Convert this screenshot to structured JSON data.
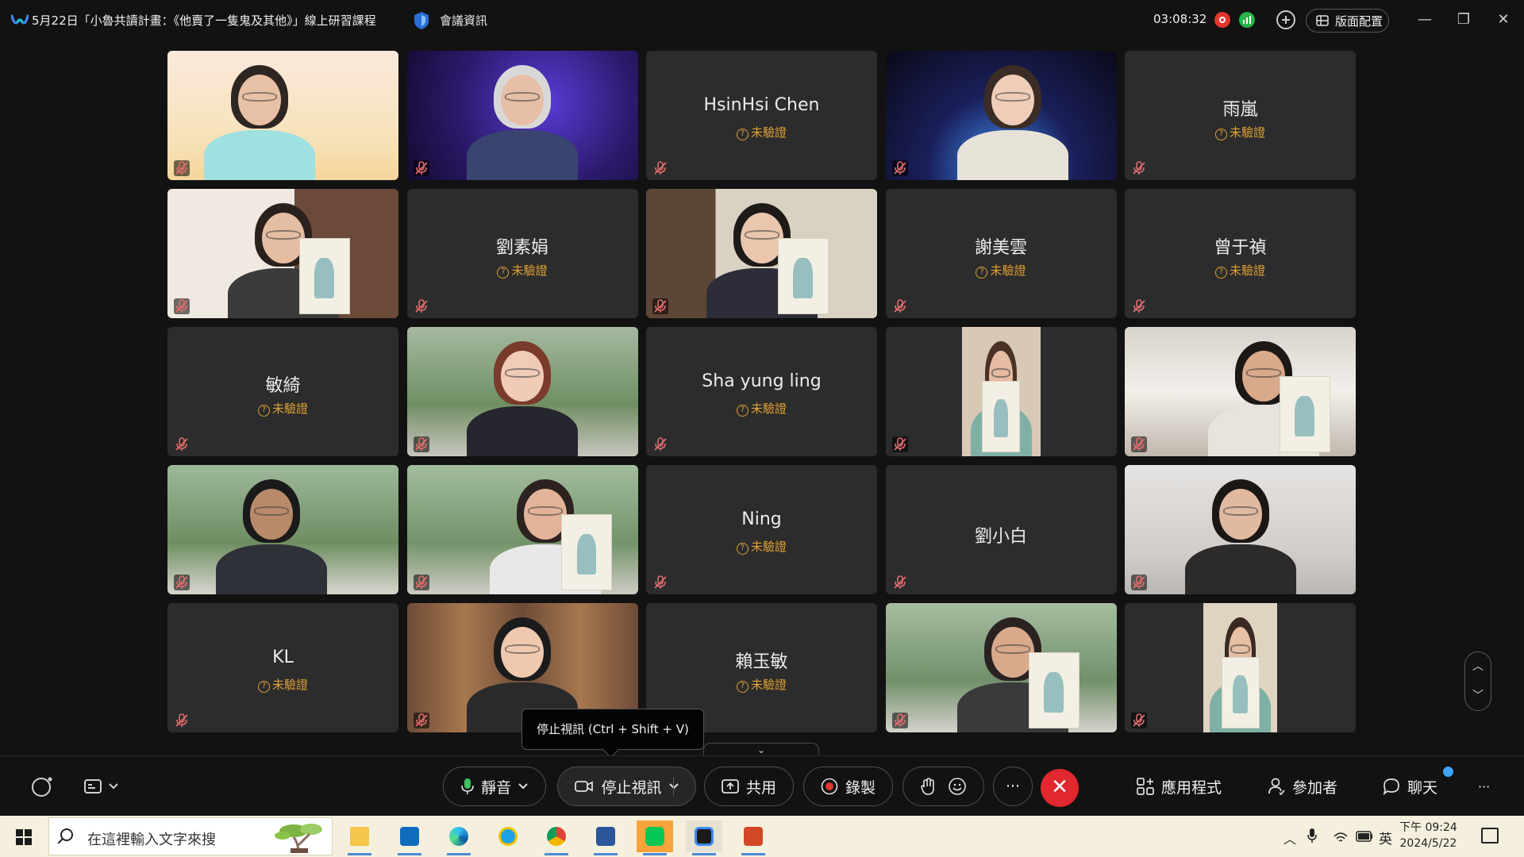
{
  "window": {
    "title": "5月22日「小魯共讀計畫：《他賣了一隻鬼及其他》」線上研習課程",
    "meeting_info_label": "會議資訊",
    "timer": "03:08:32",
    "layout_label": "版面配置",
    "minimize_glyph": "—",
    "restore_glyph": "❐",
    "close_glyph": "✕"
  },
  "participants": [
    {
      "name": "",
      "status": "",
      "video": true
    },
    {
      "name": "",
      "status": "",
      "video": true
    },
    {
      "name": "HsinHsi Chen",
      "status": "未驗證",
      "video": false
    },
    {
      "name": "",
      "status": "",
      "video": true
    },
    {
      "name": "雨嵐",
      "status": "未驗證",
      "video": false
    },
    {
      "name": "",
      "status": "",
      "video": true
    },
    {
      "name": "劉素娟",
      "status": "未驗證",
      "video": false
    },
    {
      "name": "",
      "status": "",
      "video": true
    },
    {
      "name": "謝美雲",
      "status": "未驗證",
      "video": false
    },
    {
      "name": "曾于禎",
      "status": "未驗證",
      "video": false
    },
    {
      "name": "敏綺",
      "status": "未驗證",
      "video": false
    },
    {
      "name": "",
      "status": "",
      "video": true
    },
    {
      "name": "Sha yung ling",
      "status": "未驗證",
      "video": false
    },
    {
      "name": "",
      "status": "",
      "video": true
    },
    {
      "name": "",
      "status": "",
      "video": true
    },
    {
      "name": "",
      "status": "",
      "video": true
    },
    {
      "name": "",
      "status": "",
      "video": true
    },
    {
      "name": "Ning",
      "status": "未驗證",
      "video": false
    },
    {
      "name": "劉小白",
      "status": "",
      "video": false
    },
    {
      "name": "",
      "status": "",
      "video": true
    },
    {
      "name": "KL",
      "status": "未驗證",
      "video": false
    },
    {
      "name": "",
      "status": "",
      "video": true
    },
    {
      "name": "賴玉敏",
      "status": "未驗證",
      "video": false
    },
    {
      "name": "",
      "status": "",
      "video": true
    },
    {
      "name": "",
      "status": "",
      "video": true
    }
  ],
  "tooltip": "停止視訊 (Ctrl + Shift + V)",
  "toolbar": {
    "mute_label": "靜音",
    "stop_video_label": "停止視訊",
    "share_label": "共用",
    "record_label": "錄製",
    "more_glyph": "···",
    "end_glyph": "✕",
    "apps_label": "應用程式",
    "participants_label": "參加者",
    "chat_label": "聊天",
    "overflow_glyph": "···"
  },
  "taskbar": {
    "search_placeholder": "在這裡輸入文字來搜",
    "ime_label": "英",
    "time": "下午 09:24",
    "date": "2024/5/22",
    "apps": [
      "file-explorer-icon",
      "outlook-icon",
      "edge-icon",
      "internet-explorer-icon",
      "chrome-icon",
      "word-icon",
      "line-icon",
      "webex-icon",
      "powerpoint-icon"
    ]
  },
  "colors": {
    "background": "#121212",
    "tile": "#2c2c2c",
    "unverified": "#e0a136",
    "end_call": "#e0282e",
    "taskbar": "#f5f0dd"
  }
}
